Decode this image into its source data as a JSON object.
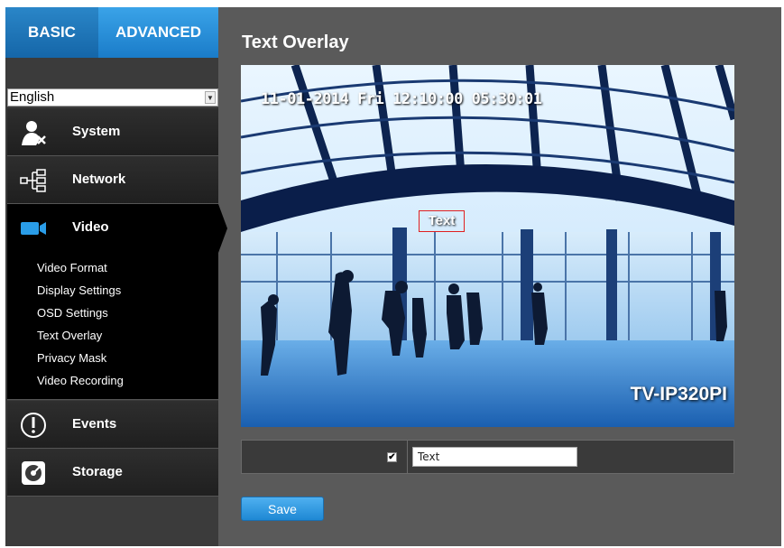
{
  "tabs": {
    "basic": "BASIC",
    "advanced": "ADVANCED"
  },
  "language": {
    "selected": "English"
  },
  "nav": {
    "system": "System",
    "network": "Network",
    "video": "Video",
    "events": "Events",
    "storage": "Storage"
  },
  "video_submenu": [
    "Video Format",
    "Display Settings",
    "OSD Settings",
    "Text Overlay",
    "Privacy Mask",
    "Video Recording"
  ],
  "page": {
    "title": "Text Overlay"
  },
  "camera": {
    "osd_time": "11-01-2014 Fri 12:10:00 05:30:01",
    "overlay_text": "Text",
    "model": "TV-IP320PI"
  },
  "overlay_setting": {
    "checked": true,
    "value": "Text"
  },
  "actions": {
    "save": "Save"
  },
  "colors": {
    "accent": "#1a7cc9",
    "sidebar": "#3b3b3b",
    "content_bg": "#5a5a5a",
    "overlay_box": "#e02020"
  }
}
